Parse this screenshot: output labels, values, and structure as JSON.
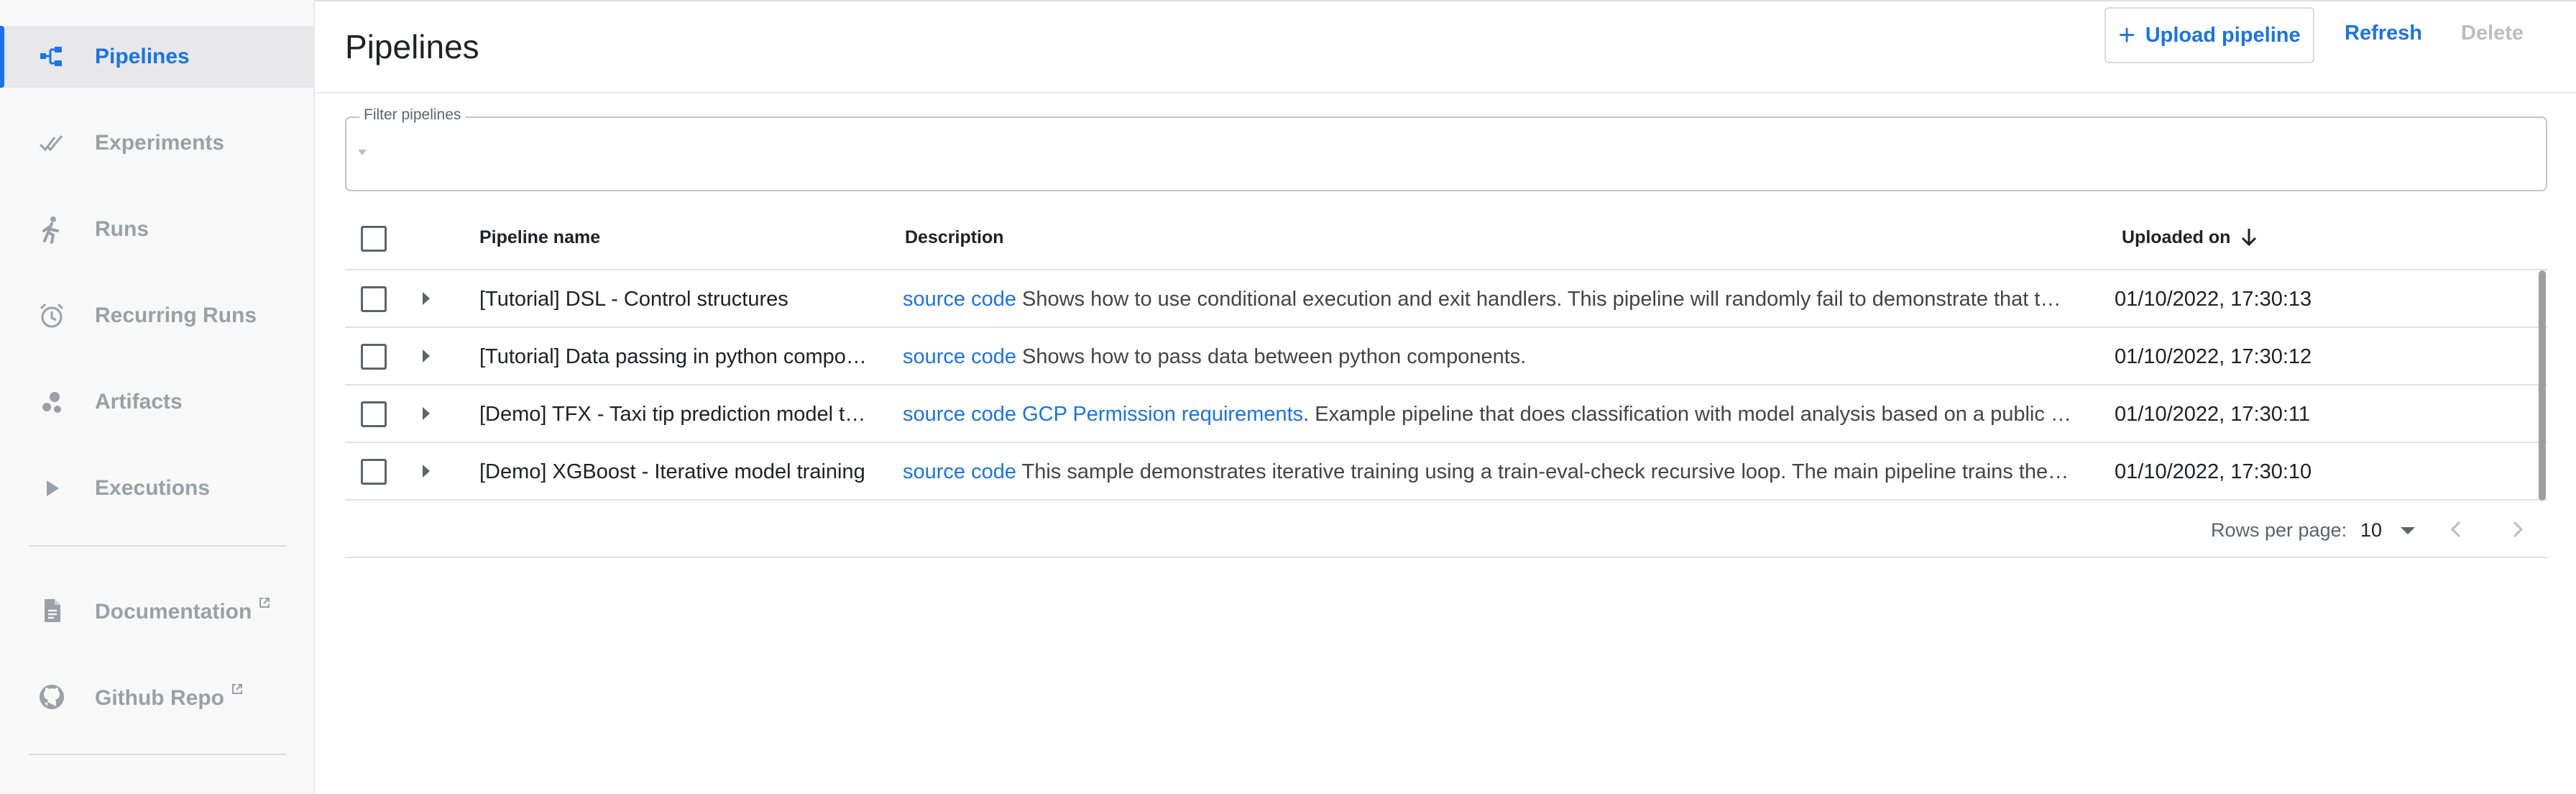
{
  "sidebar": {
    "items": [
      {
        "label": "Pipelines",
        "icon": "pipelines-icon",
        "active": true
      },
      {
        "label": "Experiments",
        "icon": "experiments-icon"
      },
      {
        "label": "Runs",
        "icon": "runs-icon"
      },
      {
        "label": "Recurring Runs",
        "icon": "alarm-clock-icon"
      },
      {
        "label": "Artifacts",
        "icon": "artifacts-icon"
      },
      {
        "label": "Executions",
        "icon": "play-icon"
      }
    ],
    "links": [
      {
        "label": "Documentation",
        "icon": "document-icon"
      },
      {
        "label": "Github Repo",
        "icon": "github-icon"
      }
    ]
  },
  "header": {
    "title": "Pipelines",
    "upload_label": "Upload pipeline",
    "refresh_label": "Refresh",
    "delete_label": "Delete"
  },
  "filter": {
    "label": "Filter pipelines",
    "value": ""
  },
  "table": {
    "columns": {
      "name": "Pipeline name",
      "description": "Description",
      "uploaded": "Uploaded on"
    },
    "sort": "Uploaded on, descending",
    "rows": [
      {
        "name": "[Tutorial] DSL - Control structures",
        "links": [
          "source code"
        ],
        "description": " Shows how to use conditional execution and exit handlers. This pipeline will randomly fail to demonstrate that t…",
        "uploaded": "01/10/2022, 17:30:13"
      },
      {
        "name": "[Tutorial] Data passing in python compo…",
        "links": [
          "source code"
        ],
        "description": " Shows how to pass data between python components.",
        "uploaded": "01/10/2022, 17:30:12"
      },
      {
        "name": "[Demo] TFX - Taxi tip prediction model t…",
        "links": [
          "source code",
          "GCP Permission requirements"
        ],
        "description": ". Example pipeline that does classification with model analysis based on a public …",
        "uploaded": "01/10/2022, 17:30:11"
      },
      {
        "name": "[Demo] XGBoost - Iterative model training",
        "links": [
          "source code"
        ],
        "description": " This sample demonstrates iterative training using a train-eval-check recursive loop. The main pipeline trains the…",
        "uploaded": "01/10/2022, 17:30:10"
      }
    ]
  },
  "pagination": {
    "rows_per_page_label": "Rows per page:",
    "rows_per_page": "10"
  },
  "colors": {
    "accent": "#1a73e8",
    "sidebar_bg": "#f8f8f9",
    "inactive_text": "#9aa0a6",
    "disabled": "#bdbdbd"
  }
}
